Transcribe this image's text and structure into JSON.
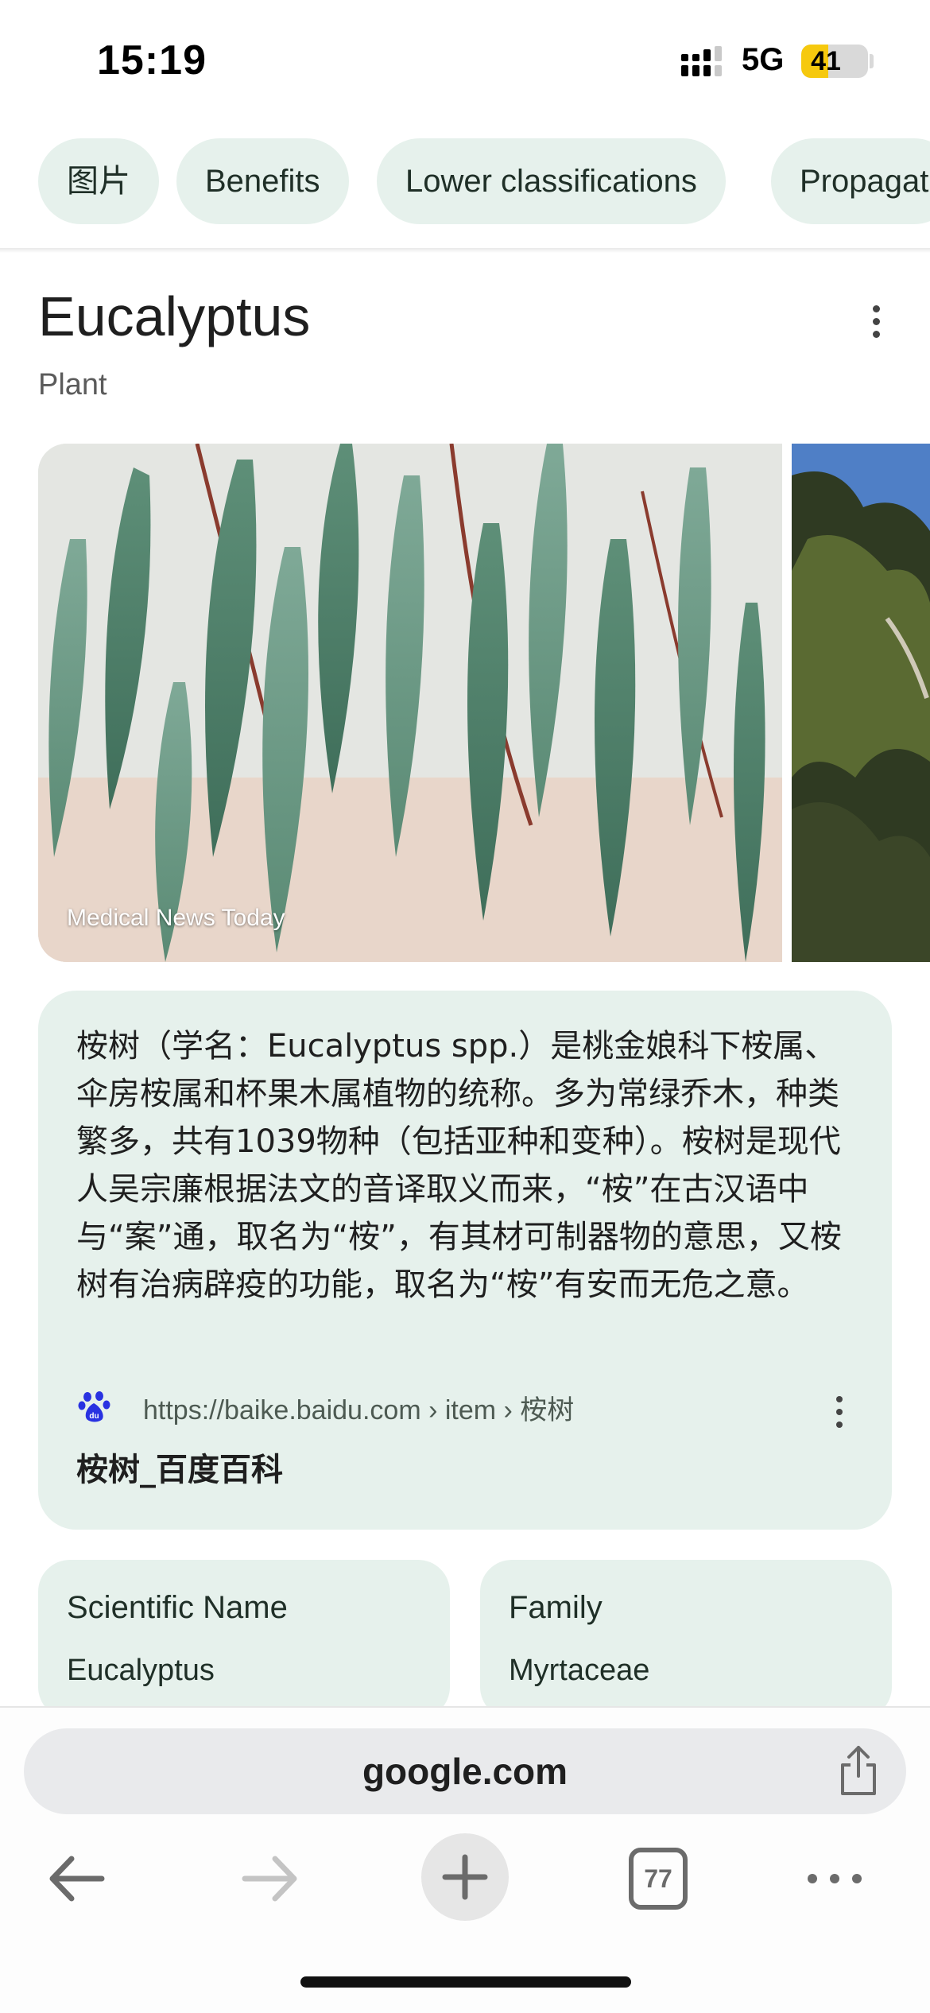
{
  "status_bar": {
    "time": "15:19",
    "network": "5G",
    "battery": "41",
    "battery_level_percent": 41
  },
  "chips": [
    "图片",
    "Benefits",
    "Lower classifications",
    "Propagat"
  ],
  "header": {
    "title": "Eucalyptus",
    "subtitle": "Plant"
  },
  "images": {
    "main_source": "Medical News Today"
  },
  "description": {
    "text": "桉树（学名：Eucalyptus spp.）是桃金娘科下桉属、伞房桉属和杯果木属植物的统称。多为常绿乔木，种类繁多，共有1039物种（包括亚种和变种）。桉树是现代人吴宗廉根据法文的音译取义而来，“桉”在古汉语中与“案”通，取名为“桉”，有其材可制器物的意思，又桉树有治病辟疫的功能，取名为“桉”有安而无危之意。",
    "source_url": "https://baike.baidu.com › item › 桉树",
    "source_title": "桉树_百度百科"
  },
  "facts": [
    {
      "label": "Scientific Name",
      "value": "Eucalyptus"
    },
    {
      "label": "Family",
      "value": "Myrtaceae"
    }
  ],
  "browser": {
    "url": "google.com",
    "tab_count": "77"
  },
  "colors": {
    "chip_bg": "#e6f1ec",
    "card_bg": "#e6f1ec",
    "battery_yellow": "#f6c90e"
  }
}
